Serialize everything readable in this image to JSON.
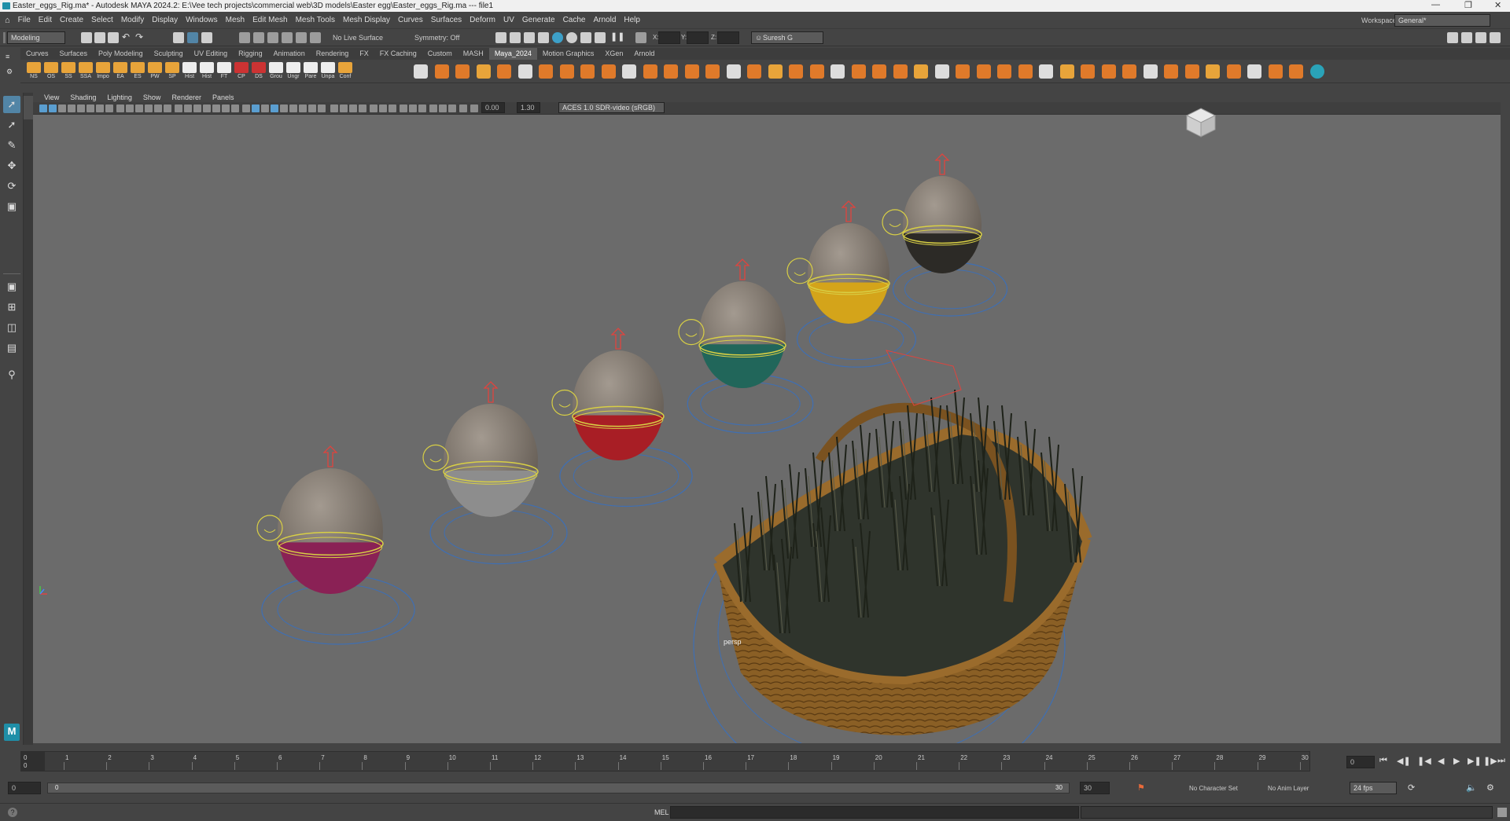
{
  "window": {
    "title": "Easter_eggs_Rig.ma* - Autodesk MAYA 2024.2: E:\\Vee tech projects\\commercial web\\3D models\\Easter egg\\Easter_eggs_Rig.ma   ---   file1"
  },
  "menubar": {
    "items": [
      "File",
      "Edit",
      "Create",
      "Select",
      "Modify",
      "Display",
      "Windows",
      "Mesh",
      "Edit Mesh",
      "Mesh Tools",
      "Mesh Display",
      "Curves",
      "Surfaces",
      "Deform",
      "UV",
      "Generate",
      "Cache",
      "Arnold",
      "Help"
    ],
    "workspace_label": "Workspace:",
    "workspace_value": "General*"
  },
  "statusline": {
    "mode": "Modeling",
    "live_surface": "No Live Surface",
    "symmetry": "Symmetry: Off",
    "x_label": "X:",
    "y_label": "Y:",
    "z_label": "Z:",
    "user": "Suresh G"
  },
  "shelf": {
    "tabs": [
      "Curves",
      "Surfaces",
      "Poly Modeling",
      "Sculpting",
      "UV Editing",
      "Rigging",
      "Animation",
      "Rendering",
      "FX",
      "FX Caching",
      "Custom",
      "MASH",
      "Maya_2024",
      "Motion Graphics",
      "XGen",
      "Arnold"
    ],
    "active_tab": "Maya_2024",
    "labeled_buttons": [
      "NS",
      "OS",
      "SS",
      "SSA",
      "Impo",
      "EA",
      "ES",
      "PW",
      "SP",
      "Hist",
      "Hist",
      "FT",
      "CP",
      "DS",
      "Grou",
      "Ungr",
      "Pare",
      "Unpa",
      "Conf"
    ]
  },
  "panel": {
    "menus": [
      "View",
      "Shading",
      "Lighting",
      "Show",
      "Renderer",
      "Panels"
    ],
    "exposure": "0.00",
    "gamma": "1.30",
    "colorspace": "ACES 1.0 SDR-video (sRGB)",
    "camera_label": "persp"
  },
  "timeline": {
    "ticks": [
      "1",
      "2",
      "3",
      "4",
      "5",
      "6",
      "7",
      "8",
      "9",
      "10",
      "11",
      "12",
      "13",
      "14",
      "15",
      "16",
      "17",
      "18",
      "19",
      "20",
      "21",
      "22",
      "23",
      "24",
      "25",
      "26",
      "27",
      "28",
      "29",
      "30"
    ],
    "current_frame_left": "0",
    "current_frame_sub": "0",
    "current_frame_right": "0"
  },
  "range": {
    "start": "0",
    "playback_start": "0",
    "playback_end": "30",
    "end": "30",
    "character_set": "No Character Set",
    "anim_layer": "No Anim Layer",
    "fps": "24 fps"
  },
  "cmdline": {
    "label": "MEL"
  },
  "colors": {
    "viewport_bg": "#6b6b6b",
    "ui_bg": "#444444",
    "accent": "#5285a6",
    "wire_blue": "#3f6fb3",
    "wire_yellow": "#d8cf45",
    "handle_red": "#e0443e",
    "egg_top": "#8a8176",
    "basket": "#8a5f25"
  }
}
